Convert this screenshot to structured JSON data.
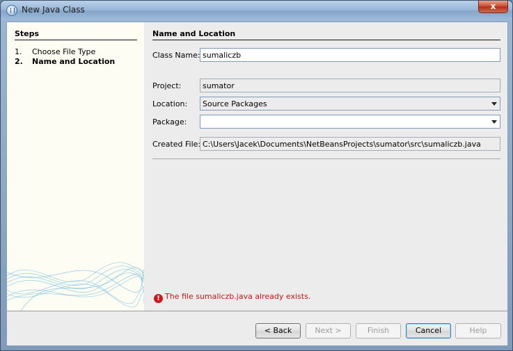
{
  "window": {
    "title": "New Java Class",
    "close_glyph": "x"
  },
  "steps": {
    "title": "Steps",
    "items": [
      {
        "num": "1.",
        "label": "Choose File Type"
      },
      {
        "num": "2.",
        "label": "Name and Location"
      }
    ]
  },
  "form": {
    "title": "Name and Location",
    "class_name_label": "Class Name:",
    "class_name_value": "sumaliczb",
    "project_label": "Project:",
    "project_value": "sumator",
    "location_label": "Location:",
    "location_value": "Source Packages",
    "package_label": "Package:",
    "package_value": "",
    "created_file_label": "Created File:",
    "created_file_value": "C:\\Users\\Jacek\\Documents\\NetBeansProjects\\sumator\\src\\sumaliczb.java"
  },
  "error": {
    "message": "The file sumaliczb.java already exists.",
    "icon": "error-icon"
  },
  "buttons": {
    "back": "< Back",
    "next": "Next >",
    "finish": "Finish",
    "cancel": "Cancel",
    "help": "Help"
  },
  "colors": {
    "error": "#c8141a",
    "steps_bg": "#fdfdf3",
    "dialog_bg": "#ececec"
  }
}
